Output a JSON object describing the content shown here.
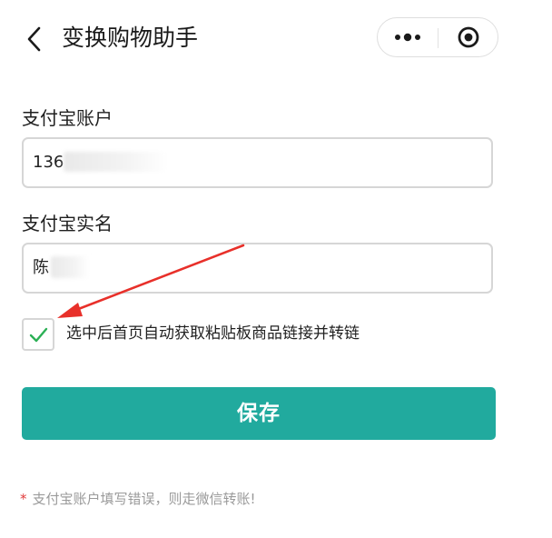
{
  "nav": {
    "title": "变换购物助手",
    "back_icon": "chevron-left-icon",
    "more_icon": "more-dots-icon",
    "close_icon": "target-close-icon"
  },
  "form": {
    "account_label": "支付宝账户",
    "account_value": "136",
    "name_label": "支付宝实名",
    "name_value": "陈",
    "checkbox_checked": true,
    "checkbox_label": "选中后首页自动获取粘贴板商品链接并转链",
    "save_label": "保存"
  },
  "note": {
    "star": "*",
    "text": "支付宝账户填写错误，则走微信转账!"
  },
  "colors": {
    "accent": "#21aa9e",
    "check": "#2bb055",
    "arrow": "#e8302a",
    "note_star": "#e03a3a"
  }
}
